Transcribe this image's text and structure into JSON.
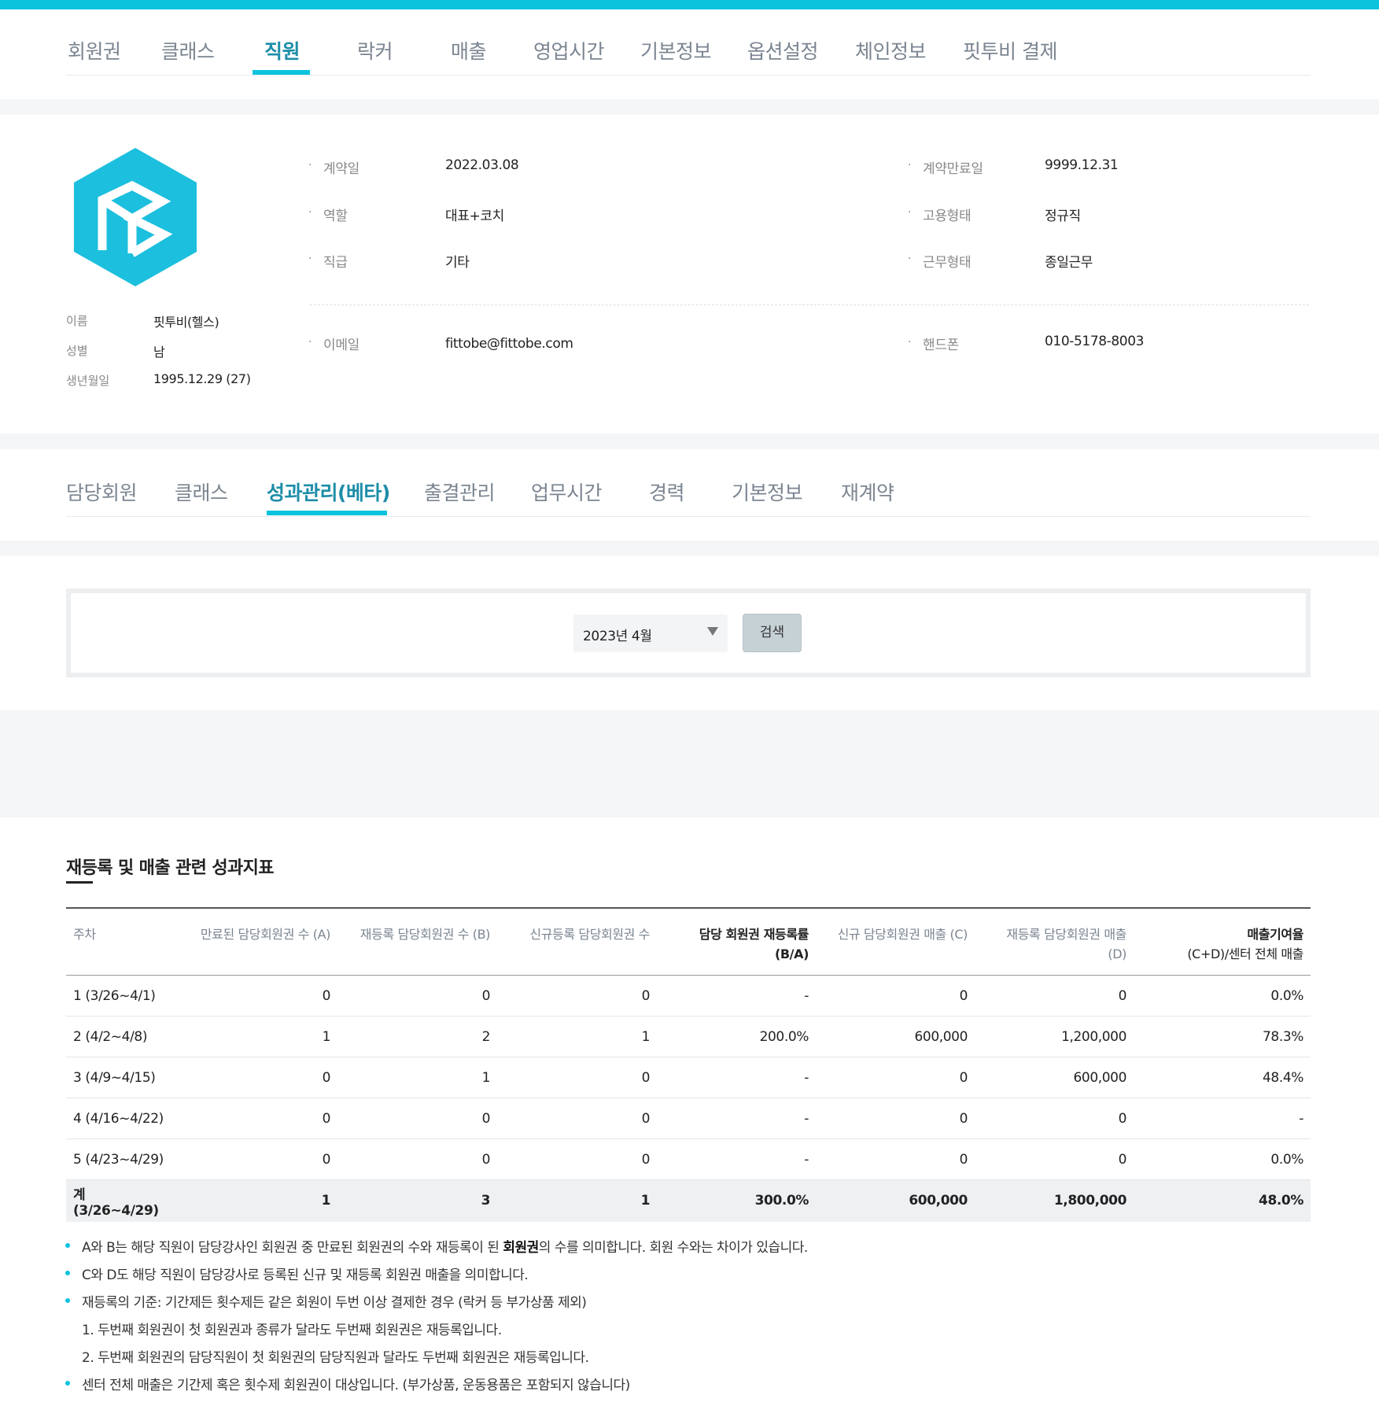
{
  "top_tabs": [
    "회원권",
    "클래스",
    "직원",
    "락커",
    "매출",
    "영업시간",
    "기본정보",
    "옵션설정",
    "체인정보",
    "핏투비 결제"
  ],
  "top_active": "직원",
  "profile": {
    "name_label": "이름",
    "name": "핏투비(헬스)",
    "gender_label": "성별",
    "gender": "남",
    "birth_label": "생년월일",
    "birth": "1995.12.29 (27)"
  },
  "fields": {
    "contract_date": {
      "label": "계약일",
      "value": "2022.03.08"
    },
    "contract_end": {
      "label": "계약만료일",
      "value": "9999.12.31"
    },
    "role": {
      "label": "역할",
      "value": "대표+코치"
    },
    "employment": {
      "label": "고용형태",
      "value": "정규직"
    },
    "rank": {
      "label": "직급",
      "value": "기타"
    },
    "work_type": {
      "label": "근무형태",
      "value": "종일근무"
    },
    "email": {
      "label": "이메일",
      "value": "fittobe@fittobe.com"
    },
    "phone": {
      "label": "핸드폰",
      "value": "010-5178-8003"
    }
  },
  "sub_tabs": [
    "담당회원",
    "클래스",
    "성과관리(베타)",
    "출결관리",
    "업무시간",
    "경력",
    "기본정보",
    "재계약"
  ],
  "sub_active": "성과관리(베타)",
  "search": {
    "month": "2023년 4월",
    "button": "검색"
  },
  "section_title": "재등록 및 매출 관련 성과지표",
  "table": {
    "headers": [
      [
        "주차",
        ""
      ],
      [
        "만료된 담당회원권 수 (A)",
        ""
      ],
      [
        "재등록 담당회원권 수 (B)",
        ""
      ],
      [
        "신규등록 담당회원권 수",
        ""
      ],
      [
        "담당 회원권 재등록률",
        "(B/A)"
      ],
      [
        "신규 담당회원권 매출 (C)",
        ""
      ],
      [
        "재등록 담당회원권 매출",
        "(D)"
      ],
      [
        "매출기여율",
        "(C+D)/센터 전체 매출"
      ]
    ],
    "rows": [
      [
        "1 (3/26~4/1)",
        "0",
        "0",
        "0",
        "-",
        "0",
        "0",
        "0.0%"
      ],
      [
        "2 (4/2~4/8)",
        "1",
        "2",
        "1",
        "200.0%",
        "600,000",
        "1,200,000",
        "78.3%"
      ],
      [
        "3 (4/9~4/15)",
        "0",
        "1",
        "0",
        "-",
        "0",
        "600,000",
        "48.4%"
      ],
      [
        "4 (4/16~4/22)",
        "0",
        "0",
        "0",
        "-",
        "0",
        "0",
        "-"
      ],
      [
        "5 (4/23~4/29)",
        "0",
        "0",
        "0",
        "-",
        "0",
        "0",
        "0.0%"
      ]
    ],
    "total": [
      "계 (3/26~4/29)",
      "1",
      "3",
      "1",
      "300.0%",
      "600,000",
      "1,800,000",
      "48.0%"
    ]
  },
  "notes": {
    "n1_a": "A와 B는 해당 직원이 담당강사인 회원권 중 만료된 회원권의 수와 재등록이 된 ",
    "n1_b": "회원권",
    "n1_c": "의 수를 의미합니다. 회원 수와는 차이가 있습니다.",
    "n2": "C와 D도 해당 직원이 담당강사로 등록된 신규 및 재등록 회원권 매출을 의미합니다.",
    "n3": "재등록의 기준: 기간제든 횟수제든 같은 회원이 두번 이상 결제한 경우 (락커 등 부가상품 제외)",
    "n3_1": "1. 두번째 회원권이 첫 회원권과 종류가 달라도 두번째 회원권은 재등록입니다.",
    "n3_2": "2. 두번째 회원권의 담당직원이 첫 회원권의 담당직원과 달라도 두번째 회원권은 재등록입니다.",
    "n4": "센터 전체 매출은 기간제 혹은 횟수제 회원권이 대상입니다. (부가상품, 운동용품은 포함되지 않습니다)"
  },
  "colors": {
    "accent": "#0cc3de",
    "active_text": "#1d8ea8"
  }
}
